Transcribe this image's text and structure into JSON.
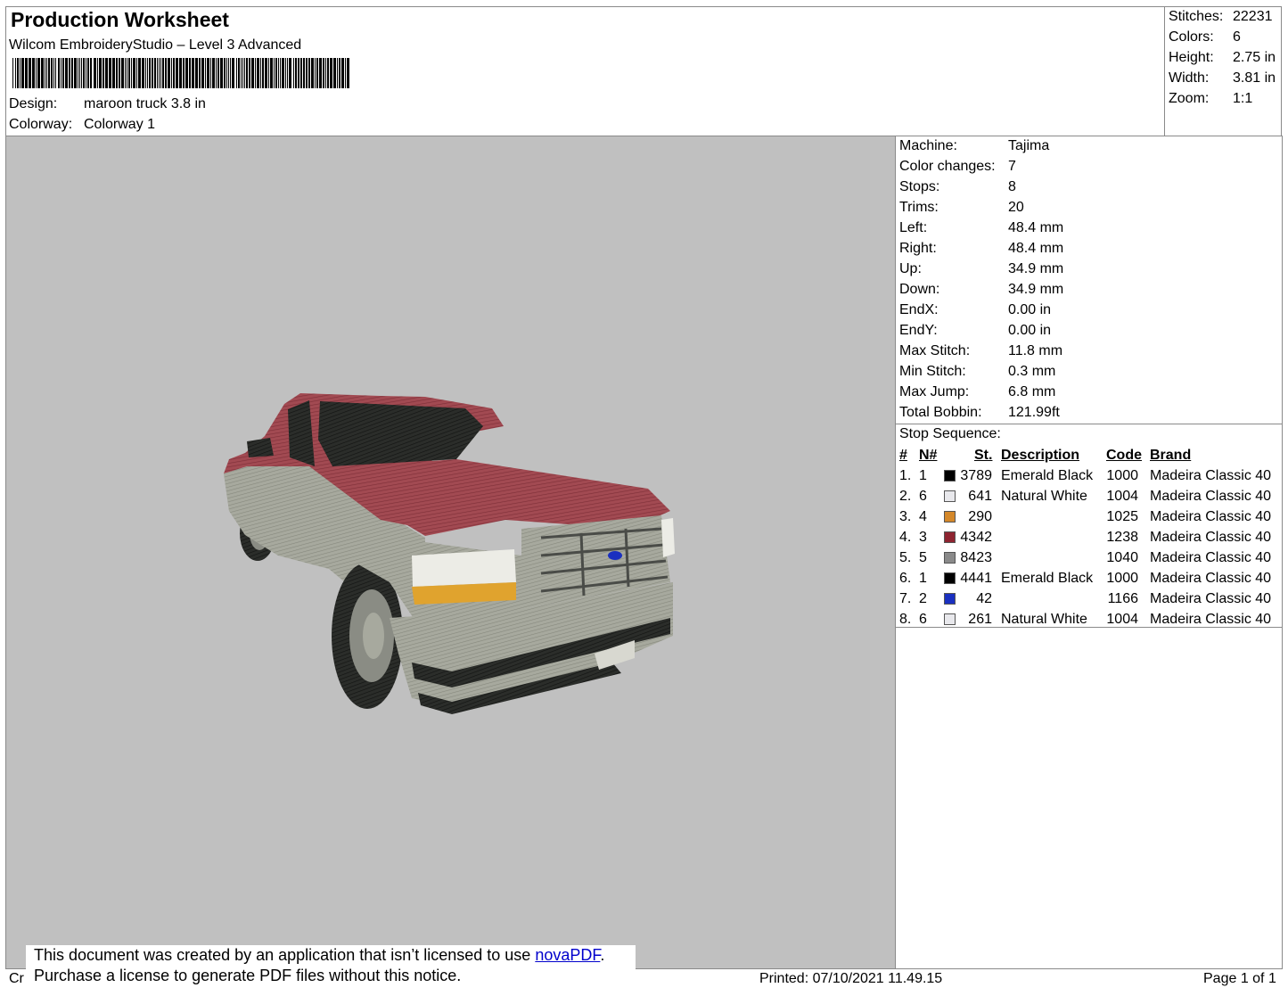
{
  "header": {
    "title": "Production Worksheet",
    "subtitle": "Wilcom EmbroideryStudio – Level 3 Advanced",
    "design_label": "Design:",
    "design_value": "maroon truck 3.8 in",
    "colorway_label": "Colorway:",
    "colorway_value": "Colorway 1"
  },
  "top_stats": [
    {
      "label": "Stitches:",
      "value": "22231"
    },
    {
      "label": "Colors:",
      "value": "6"
    },
    {
      "label": "Height:",
      "value": "2.75 in"
    },
    {
      "label": "Width:",
      "value": "3.81 in"
    },
    {
      "label": "Zoom:",
      "value": "1:1"
    }
  ],
  "info": [
    {
      "label": "Machine:",
      "value": "Tajima"
    },
    {
      "label": "Color changes:",
      "value": "7"
    },
    {
      "label": "Stops:",
      "value": "8"
    },
    {
      "label": "Trims:",
      "value": "20"
    },
    {
      "label": "Left:",
      "value": "48.4 mm"
    },
    {
      "label": "Right:",
      "value": "48.4 mm"
    },
    {
      "label": "Up:",
      "value": "34.9 mm"
    },
    {
      "label": "Down:",
      "value": "34.9 mm"
    },
    {
      "label": "EndX:",
      "value": "0.00 in"
    },
    {
      "label": "EndY:",
      "value": "0.00 in"
    },
    {
      "label": "Max Stitch:",
      "value": "11.8 mm"
    },
    {
      "label": "Min Stitch:",
      "value": "0.3 mm"
    },
    {
      "label": "Max Jump:",
      "value": "6.8 mm"
    },
    {
      "label": "Total Bobbin:",
      "value": "121.99ft"
    }
  ],
  "stop_sequence": {
    "title": "Stop Sequence:",
    "headers": {
      "num": "#",
      "n": "N#",
      "st": "St.",
      "desc": "Description",
      "code": "Code",
      "brand": "Brand"
    },
    "rows": [
      {
        "num": "1.",
        "n": "1",
        "color": "#000000",
        "st": "3789",
        "desc": "Emerald Black",
        "code": "1000",
        "brand": "Madeira Classic 40"
      },
      {
        "num": "2.",
        "n": "6",
        "color": "#e8e8ec",
        "st": "641",
        "desc": "Natural White",
        "code": "1004",
        "brand": "Madeira Classic 40"
      },
      {
        "num": "3.",
        "n": "4",
        "color": "#d4882a",
        "st": "290",
        "desc": "",
        "code": "1025",
        "brand": "Madeira Classic 40"
      },
      {
        "num": "4.",
        "n": "3",
        "color": "#8e2430",
        "st": "4342",
        "desc": "",
        "code": "1238",
        "brand": "Madeira Classic 40"
      },
      {
        "num": "5.",
        "n": "5",
        "color": "#8a8a8a",
        "st": "8423",
        "desc": "",
        "code": "1040",
        "brand": "Madeira Classic 40"
      },
      {
        "num": "6.",
        "n": "1",
        "color": "#000000",
        "st": "4441",
        "desc": "Emerald Black",
        "code": "1000",
        "brand": "Madeira Classic 40"
      },
      {
        "num": "7.",
        "n": "2",
        "color": "#1a30c0",
        "st": "42",
        "desc": "",
        "code": "1166",
        "brand": "Madeira Classic 40"
      },
      {
        "num": "8.",
        "n": "6",
        "color": "#e8e8ec",
        "st": "261",
        "desc": "Natural White",
        "code": "1004",
        "brand": "Madeira Classic 40"
      }
    ]
  },
  "footer": {
    "cr": "Cr",
    "printed": "Printed: 07/10/2021 11.49.15",
    "page": "Page 1 of 1"
  },
  "notice": {
    "line1_pre": "This document was created by an application that isn’t licensed to use ",
    "link": "novaPDF",
    "line1_post": ".",
    "line2": "Purchase a license to generate PDF files without this notice."
  }
}
